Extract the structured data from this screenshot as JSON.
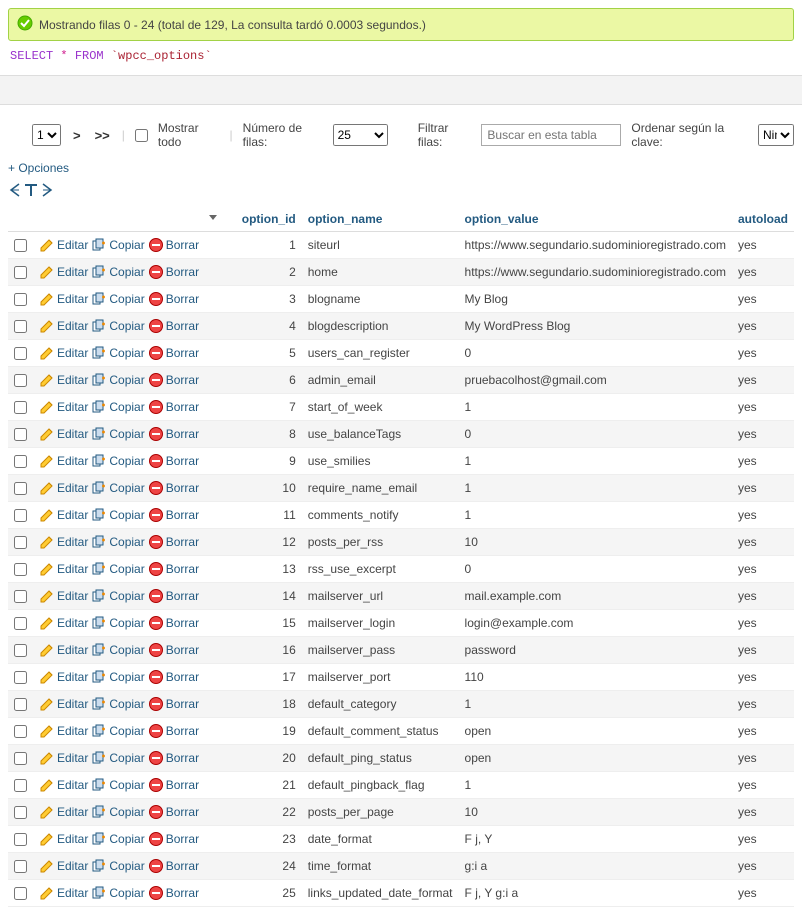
{
  "status": {
    "message": "Mostrando filas 0 - 24 (total de 129, La consulta tardó 0.0003 segundos.)"
  },
  "sql": {
    "select": "SELECT",
    "star": "*",
    "from": "FROM",
    "table": "`wpcc_options`"
  },
  "nav": {
    "page_value": "1",
    "next": ">",
    "last": ">>",
    "show_all": "Mostrar todo",
    "num_rows_label": "Número de filas:",
    "num_rows_value": "25",
    "filter_label": "Filtrar filas:",
    "filter_placeholder": "Buscar en esta tabla",
    "sort_label": "Ordenar según la clave:",
    "sort_value": "Ning"
  },
  "options_link": "+ Opciones",
  "actions": {
    "edit": "Editar",
    "copy": "Copiar",
    "delete": "Borrar"
  },
  "columns": {
    "option_id": "option_id",
    "option_name": "option_name",
    "option_value": "option_value",
    "autoload": "autoload"
  },
  "rows": [
    {
      "id": "1",
      "name": "siteurl",
      "value": "https://www.segundario.sudominioregistrado.com",
      "autoload": "yes"
    },
    {
      "id": "2",
      "name": "home",
      "value": "https://www.segundario.sudominioregistrado.com",
      "autoload": "yes"
    },
    {
      "id": "3",
      "name": "blogname",
      "value": "My Blog",
      "autoload": "yes"
    },
    {
      "id": "4",
      "name": "blogdescription",
      "value": "My WordPress Blog",
      "autoload": "yes"
    },
    {
      "id": "5",
      "name": "users_can_register",
      "value": "0",
      "autoload": "yes"
    },
    {
      "id": "6",
      "name": "admin_email",
      "value": "pruebacolhost@gmail.com",
      "autoload": "yes"
    },
    {
      "id": "7",
      "name": "start_of_week",
      "value": "1",
      "autoload": "yes"
    },
    {
      "id": "8",
      "name": "use_balanceTags",
      "value": "0",
      "autoload": "yes"
    },
    {
      "id": "9",
      "name": "use_smilies",
      "value": "1",
      "autoload": "yes"
    },
    {
      "id": "10",
      "name": "require_name_email",
      "value": "1",
      "autoload": "yes"
    },
    {
      "id": "11",
      "name": "comments_notify",
      "value": "1",
      "autoload": "yes"
    },
    {
      "id": "12",
      "name": "posts_per_rss",
      "value": "10",
      "autoload": "yes"
    },
    {
      "id": "13",
      "name": "rss_use_excerpt",
      "value": "0",
      "autoload": "yes"
    },
    {
      "id": "14",
      "name": "mailserver_url",
      "value": "mail.example.com",
      "autoload": "yes"
    },
    {
      "id": "15",
      "name": "mailserver_login",
      "value": "login@example.com",
      "autoload": "yes"
    },
    {
      "id": "16",
      "name": "mailserver_pass",
      "value": "password",
      "autoload": "yes"
    },
    {
      "id": "17",
      "name": "mailserver_port",
      "value": "110",
      "autoload": "yes"
    },
    {
      "id": "18",
      "name": "default_category",
      "value": "1",
      "autoload": "yes"
    },
    {
      "id": "19",
      "name": "default_comment_status",
      "value": "open",
      "autoload": "yes"
    },
    {
      "id": "20",
      "name": "default_ping_status",
      "value": "open",
      "autoload": "yes"
    },
    {
      "id": "21",
      "name": "default_pingback_flag",
      "value": "1",
      "autoload": "yes"
    },
    {
      "id": "22",
      "name": "posts_per_page",
      "value": "10",
      "autoload": "yes"
    },
    {
      "id": "23",
      "name": "date_format",
      "value": "F j, Y",
      "autoload": "yes"
    },
    {
      "id": "24",
      "name": "time_format",
      "value": "g:i a",
      "autoload": "yes"
    },
    {
      "id": "25",
      "name": "links_updated_date_format",
      "value": "F j, Y g:i a",
      "autoload": "yes"
    }
  ]
}
